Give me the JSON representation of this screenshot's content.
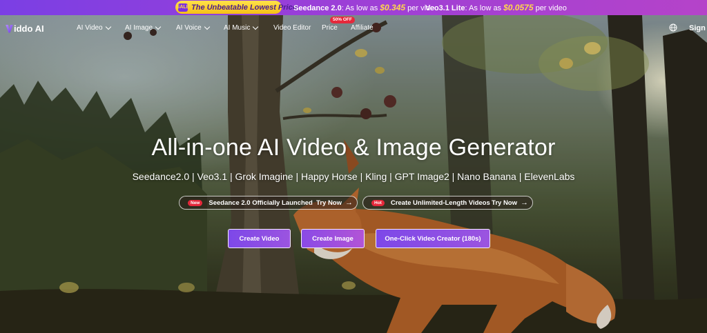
{
  "promo": {
    "pill_badge": "SALE",
    "pill_text": "The Unbeatable Lowest Price",
    "offers": [
      {
        "name": "Seedance 2.0",
        "prefix": ":  As low as ",
        "price": "$0.345",
        "suffix": " per video"
      },
      {
        "name": "Veo3.1 Lite",
        "prefix": ":  As low as ",
        "price": "$0.0575",
        "suffix": " per video"
      }
    ],
    "colors": {
      "bar": "#8a3fe0",
      "pill": "#f9cf27",
      "price": "#ffd94a"
    }
  },
  "nav": {
    "logo": "iddo AI",
    "items": [
      {
        "label": "AI Video",
        "dropdown": true
      },
      {
        "label": "AI Image",
        "dropdown": true
      },
      {
        "label": "AI Voice",
        "dropdown": true
      },
      {
        "label": "AI Music",
        "dropdown": true
      },
      {
        "label": "Video Editor",
        "dropdown": false
      },
      {
        "label": "Price",
        "dropdown": false
      },
      {
        "label": "Affiliate",
        "dropdown": false
      }
    ],
    "price_badge": "50% OFF",
    "sign_in": "Sign I",
    "icons": {
      "language": "globe-icon",
      "dropdown": "chevron-down-icon"
    }
  },
  "hero": {
    "headline": "All-in-one AI Video & Image Generator",
    "subline": "Seedance2.0 | Veo3.1 | Grok Imagine | Happy Horse | Kling | GPT Image2 | Nano Banana | ElevenLabs",
    "announcements": [
      {
        "badge": "New",
        "text": "Seedance 2.0 Officially Launched",
        "action": "Try Now",
        "arrow": "→"
      },
      {
        "badge": "Hot",
        "text": "Create Unlimited-Length Videos",
        "action": "Try Now",
        "arrow": "→"
      }
    ],
    "buttons": {
      "create_video": "Create Video",
      "create_image": "Create Image",
      "one_click": "One-Click Video Creator (180s)"
    },
    "colors": {
      "button": "#8a4ae6",
      "badge": "#e5283b"
    }
  }
}
